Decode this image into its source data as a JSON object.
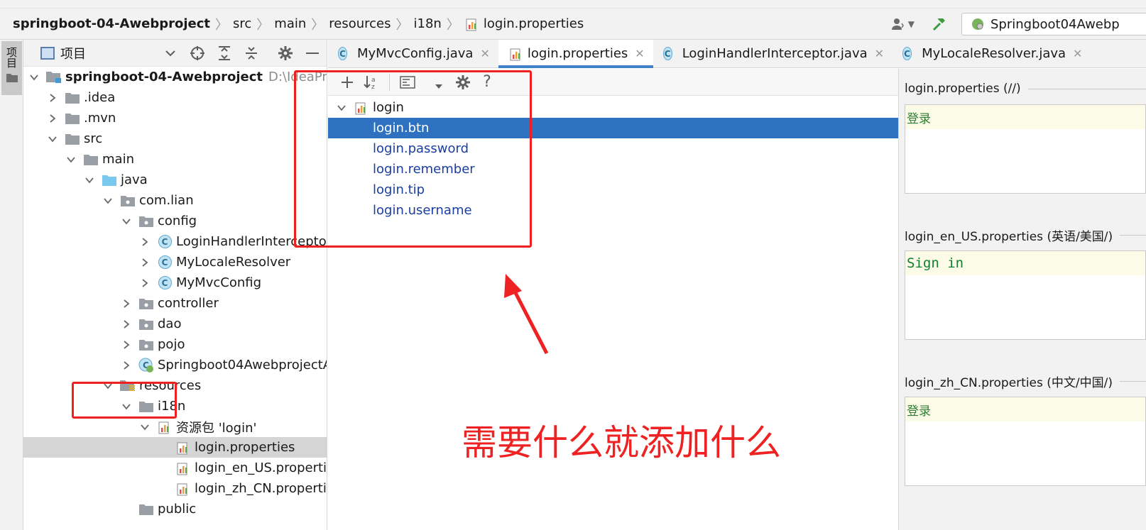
{
  "breadcrumb": [
    {
      "label": "springboot-04-Awebproject",
      "bold": true
    },
    {
      "label": "src"
    },
    {
      "label": "main"
    },
    {
      "label": "resources"
    },
    {
      "label": "i18n"
    },
    {
      "label": "login.properties",
      "icon": "properties-file-icon"
    }
  ],
  "run_config": {
    "label": "Springboot04Awebp"
  },
  "tool_strip": {
    "label": "项目"
  },
  "project_panel": {
    "title": "项目",
    "tree": [
      {
        "label": "springboot-04-Awebproject",
        "path": "D:\\IdeaProjec",
        "depth": 0,
        "expanded": true,
        "icon": "module-folder-icon",
        "bold": true
      },
      {
        "label": ".idea",
        "depth": 1,
        "expanded": false,
        "icon": "folder-icon"
      },
      {
        "label": ".mvn",
        "depth": 1,
        "expanded": false,
        "icon": "folder-icon"
      },
      {
        "label": "src",
        "depth": 1,
        "expanded": true,
        "icon": "folder-icon"
      },
      {
        "label": "main",
        "depth": 2,
        "expanded": true,
        "icon": "folder-icon"
      },
      {
        "label": "java",
        "depth": 3,
        "expanded": true,
        "icon": "source-folder-icon"
      },
      {
        "label": "com.lian",
        "depth": 4,
        "expanded": true,
        "icon": "package-icon"
      },
      {
        "label": "config",
        "depth": 5,
        "expanded": true,
        "icon": "package-icon"
      },
      {
        "label": "LoginHandlerInterceptor",
        "depth": 6,
        "expanded": false,
        "icon": "class-icon"
      },
      {
        "label": "MyLocaleResolver",
        "depth": 6,
        "expanded": false,
        "icon": "class-icon"
      },
      {
        "label": "MyMvcConfig",
        "depth": 6,
        "expanded": false,
        "icon": "class-icon"
      },
      {
        "label": "controller",
        "depth": 5,
        "expanded": false,
        "icon": "package-icon"
      },
      {
        "label": "dao",
        "depth": 5,
        "expanded": false,
        "icon": "package-icon"
      },
      {
        "label": "pojo",
        "depth": 5,
        "expanded": false,
        "icon": "package-icon"
      },
      {
        "label": "Springboot04AwebprojectA",
        "depth": 5,
        "expanded": false,
        "icon": "spring-boot-class-icon"
      },
      {
        "label": "resources",
        "depth": 4,
        "expanded": true,
        "icon": "resources-folder-icon"
      },
      {
        "label": "i18n",
        "depth": 5,
        "expanded": true,
        "icon": "folder-icon"
      },
      {
        "label": "资源包 'login'",
        "depth": 6,
        "expanded": true,
        "icon": "resource-bundle-icon"
      },
      {
        "label": "login.properties",
        "depth": 7,
        "leaf": true,
        "icon": "properties-file-icon",
        "selected": true
      },
      {
        "label": "login_en_US.properties",
        "depth": 7,
        "leaf": true,
        "icon": "properties-file-icon"
      },
      {
        "label": "login_zh_CN.properties",
        "depth": 7,
        "leaf": true,
        "icon": "properties-file-icon"
      },
      {
        "label": "public",
        "depth": 5,
        "leaf": true,
        "icon": "folder-icon"
      }
    ]
  },
  "tabs": [
    {
      "label": "MyMvcConfig.java",
      "icon": "class-icon",
      "active": false
    },
    {
      "label": "login.properties",
      "icon": "properties-file-icon",
      "active": true
    },
    {
      "label": "LoginHandlerInterceptor.java",
      "icon": "class-icon",
      "active": false
    },
    {
      "label": "MyLocaleResolver.java",
      "icon": "class-icon",
      "active": false
    }
  ],
  "bundle_editor": {
    "root": "login",
    "keys": [
      "login.btn",
      "login.password",
      "login.remember",
      "login.tip",
      "login.username"
    ],
    "selected_key": "login.btn"
  },
  "values_panel": [
    {
      "title": "login.properties (//)",
      "value": "登录",
      "mono": false
    },
    {
      "title": "login_en_US.properties (英语/美国/)",
      "value": "Sign in",
      "mono": true
    },
    {
      "title": "login_zh_CN.properties (中文/中国/)",
      "value": "登录",
      "mono": false
    }
  ],
  "annotation": {
    "text": "需要什么就添加什么"
  },
  "colors": {
    "selection": "#2d71c0",
    "annotation": "#f02020",
    "key_text": "#1a3ea0"
  }
}
